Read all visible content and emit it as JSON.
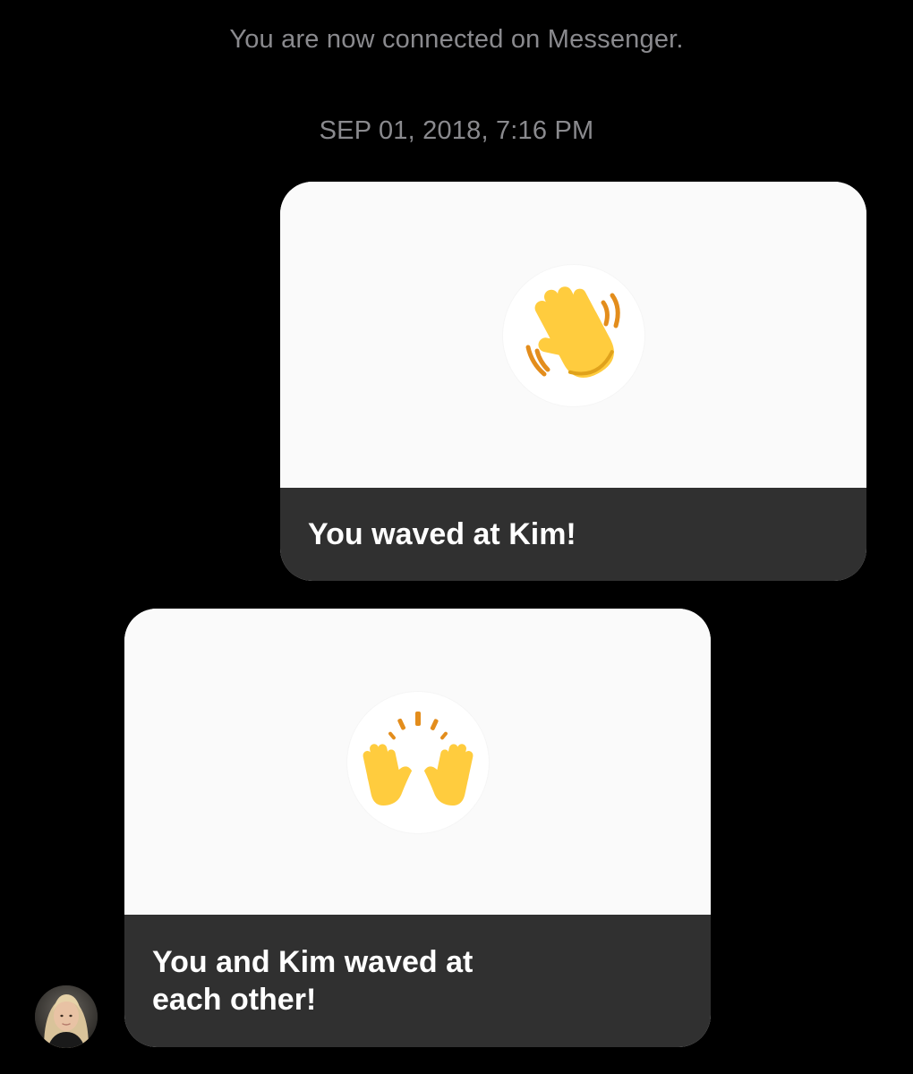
{
  "thread": {
    "connected_notice": "You are now connected on Messenger.",
    "timestamp": "SEP 01, 2018, 7:16 PM"
  },
  "messages": [
    {
      "direction": "sent",
      "emoji_icon": "waving-hand-icon",
      "caption": "You waved at Kim!"
    },
    {
      "direction": "received",
      "emoji_icon": "raising-hands-icon",
      "caption": "You and Kim waved at each other!"
    }
  ],
  "contact": {
    "avatar_icon": "contact-avatar"
  },
  "colors": {
    "background": "#000000",
    "system_text": "#8a8a8e",
    "card_media": "#fafafa",
    "card_caption": "#303030",
    "emoji_yellow": "#ffcc3e",
    "emoji_orange": "#e38d1c"
  }
}
